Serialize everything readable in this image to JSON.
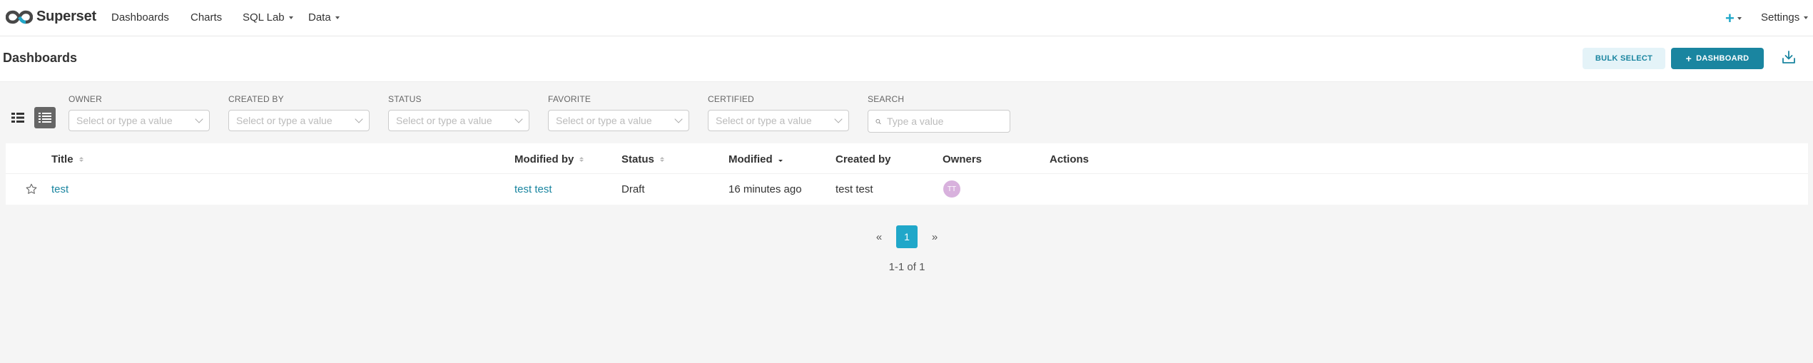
{
  "navbar": {
    "brand": "Superset",
    "items": [
      {
        "label": "Dashboards",
        "dropdown": false
      },
      {
        "label": "Charts",
        "dropdown": false
      },
      {
        "label": "SQL Lab",
        "dropdown": true
      },
      {
        "label": "Data",
        "dropdown": true
      }
    ],
    "plus_label": "+",
    "settings_label": "Settings"
  },
  "subheader": {
    "title": "Dashboards",
    "bulk_select_label": "Bulk Select",
    "new_dashboard_label": "Dashboard",
    "new_dashboard_icon": "plus-icon",
    "download_icon": "download-icon"
  },
  "filters": [
    {
      "label": "Owner",
      "placeholder": "Select or type a value"
    },
    {
      "label": "Created by",
      "placeholder": "Select or type a value"
    },
    {
      "label": "Status",
      "placeholder": "Select or type a value"
    },
    {
      "label": "Favorite",
      "placeholder": "Select or type a value"
    },
    {
      "label": "Certified",
      "placeholder": "Select or type a value"
    }
  ],
  "search": {
    "label": "Search",
    "placeholder": "Type a value"
  },
  "table": {
    "columns": [
      "Title",
      "Modified by",
      "Status",
      "Modified",
      "Created by",
      "Owners",
      "Actions"
    ],
    "rows": [
      {
        "favorite": false,
        "title": "test",
        "modified_by": "test test",
        "status": "Draft",
        "modified": "16 minutes ago",
        "created_by": "test test",
        "owner_initials": "TT"
      }
    ]
  },
  "pagination": {
    "prev": "«",
    "current": "1",
    "next": "»",
    "range_text": "1-1 of 1"
  },
  "colors": {
    "primary": "#1a85a0",
    "primary_light": "#20a7c9",
    "avatar": "#d8b1dd"
  }
}
